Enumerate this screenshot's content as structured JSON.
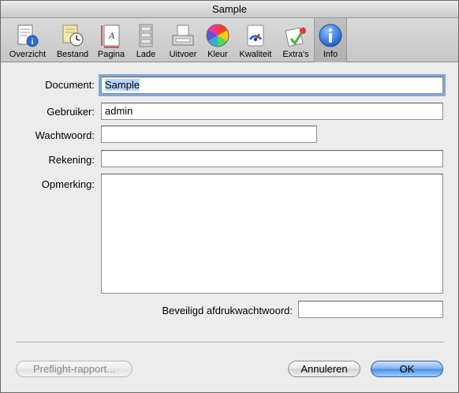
{
  "window": {
    "title": "Sample"
  },
  "toolbar": {
    "items": [
      {
        "label": "Overzicht",
        "icon": "summary-icon"
      },
      {
        "label": "Bestand",
        "icon": "file-clock-icon"
      },
      {
        "label": "Pagina",
        "icon": "page-icon"
      },
      {
        "label": "Lade",
        "icon": "tray-icon"
      },
      {
        "label": "Uitvoer",
        "icon": "output-icon"
      },
      {
        "label": "Kleur",
        "icon": "color-wheel-icon"
      },
      {
        "label": "Kwaliteit",
        "icon": "quality-gauge-icon"
      },
      {
        "label": "Extra's",
        "icon": "extras-icon"
      },
      {
        "label": "Info",
        "icon": "info-icon"
      }
    ],
    "selected": "Info"
  },
  "form": {
    "document_label": "Document:",
    "document_value": "Sample",
    "user_label": "Gebruiker:",
    "user_value": "admin",
    "password_label": "Wachtwoord:",
    "password_value": "",
    "account_label": "Rekening:",
    "account_value": "",
    "remark_label": "Opmerking:",
    "remark_value": "",
    "secure_print_label": "Beveiligd afdrukwachtwoord:",
    "secure_print_value": ""
  },
  "buttons": {
    "preflight": "Preflight-rapport...",
    "cancel": "Annuleren",
    "ok": "OK"
  },
  "colors": {
    "accent": "#4b8ce0",
    "focus_ring": "#7fa7dc",
    "info_blue": "#2a6fd6"
  }
}
